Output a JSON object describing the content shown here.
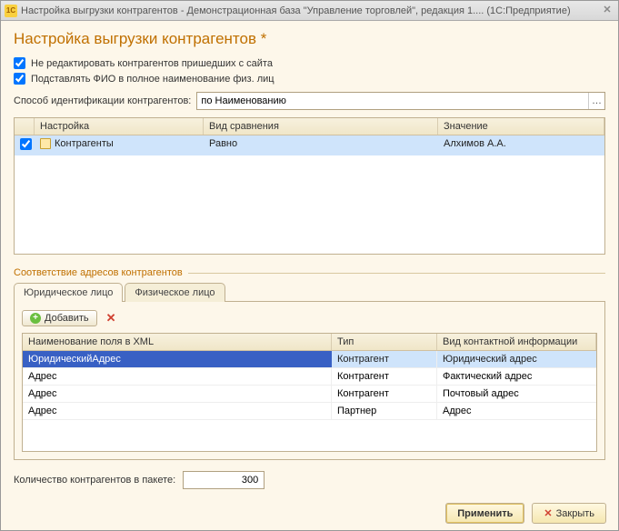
{
  "window": {
    "title": "Настройка выгрузки контрагентов - Демонстрационная база \"Управление торговлей\", редакция 1....   (1С:Предприятие)",
    "appicon": "1C"
  },
  "page": {
    "title": "Настройка выгрузки контрагентов *"
  },
  "checkboxes": {
    "no_edit": "Не редактировать контрагентов пришедших с сайта",
    "subst_fio": "Подставлять ФИО в полное наименование физ. лиц"
  },
  "ident": {
    "label": "Способ идентификации контрагентов:",
    "value": "по Наименованию"
  },
  "filter_grid": {
    "headers": {
      "check": "",
      "setting": "Настройка",
      "cmp": "Вид сравнения",
      "val": "Значение"
    },
    "row": {
      "setting": "Контрагенты",
      "cmp": "Равно",
      "val": "Алхимов А.А."
    }
  },
  "addr_section": "Соответствие адресов контрагентов",
  "tabs": {
    "legal": "Юридическое лицо",
    "phys": "Физическое лицо"
  },
  "toolbar": {
    "add": "Добавить"
  },
  "addr_grid": {
    "headers": {
      "name": "Наименование поля в XML",
      "type": "Тип",
      "kind": "Вид контактной информации"
    },
    "rows": [
      {
        "name": "ЮридическийАдрес",
        "type": "Контрагент",
        "kind": "Юридический адрес"
      },
      {
        "name": "Адрес",
        "type": "Контрагент",
        "kind": "Фактический адрес"
      },
      {
        "name": "Адрес",
        "type": "Контрагент",
        "kind": "Почтовый адрес"
      },
      {
        "name": "Адрес",
        "type": "Партнер",
        "kind": "Адрес"
      }
    ]
  },
  "batch": {
    "label": "Количество контрагентов в пакете:",
    "value": "300"
  },
  "footer": {
    "apply": "Применить",
    "close": "Закрыть"
  }
}
